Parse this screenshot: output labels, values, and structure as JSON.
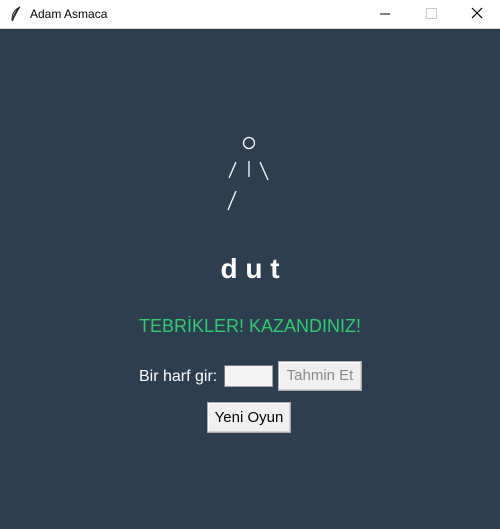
{
  "window": {
    "title": "Adam Asmaca",
    "icon": "feather-icon",
    "controls": [
      "minimize-icon",
      "maximize-icon",
      "close-icon"
    ]
  },
  "game": {
    "hangman_parts": [
      "head",
      "body",
      "left-arm",
      "right-arm",
      "left-leg"
    ],
    "word_display": "d u t",
    "status_message": "TEBRİKLER! KAZANDINIZ!",
    "input_label": "Bir harf gir:",
    "input_value": "",
    "guess_button_label": "Tahmin Et",
    "guess_button_enabled": false,
    "new_game_button_label": "Yeni Oyun"
  },
  "colors": {
    "background": "#2c3e50",
    "status_success": "#2ecc71",
    "text": "#ffffff"
  }
}
